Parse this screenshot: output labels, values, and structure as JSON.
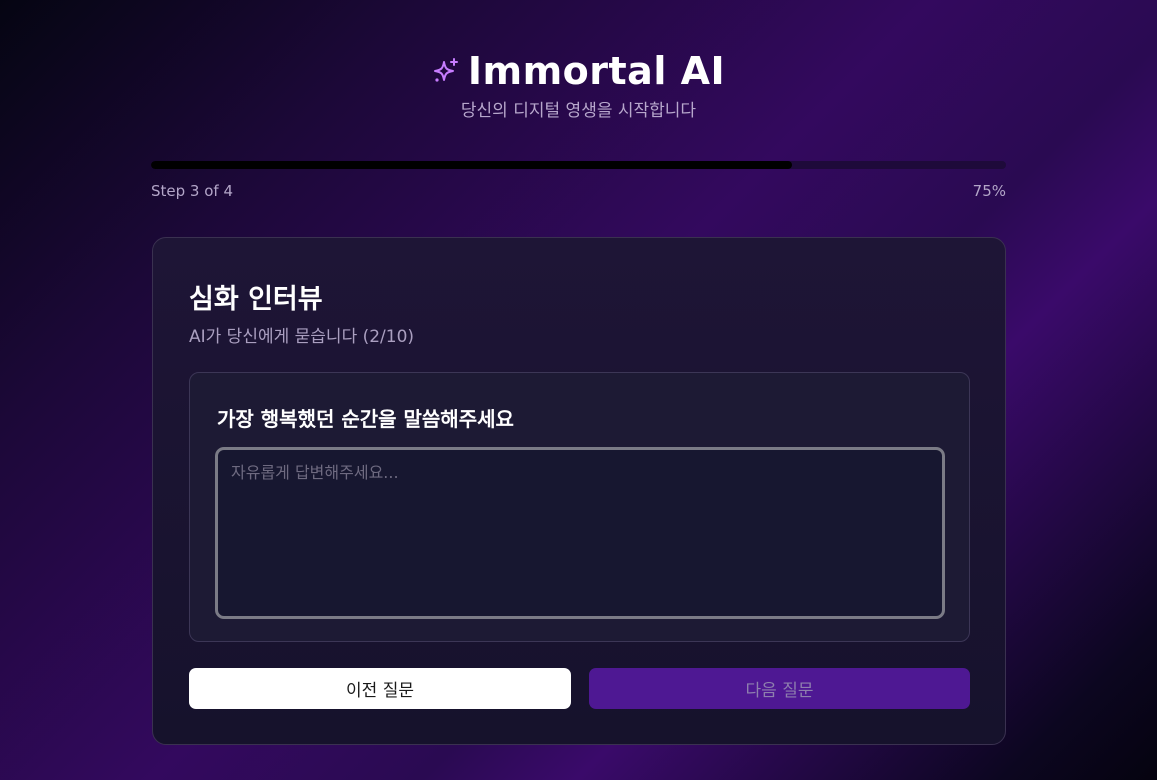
{
  "header": {
    "logo_icon": "sparkle-icon",
    "title": "Immortal AI",
    "subtitle": "당신의 디지털 영생을 시작합니다"
  },
  "progress": {
    "step_text": "Step 3 of 4",
    "percent_text": "75%",
    "fraction": 0.75
  },
  "card": {
    "title": "심화 인터뷰",
    "subtitle": "AI가 당신에게 묻습니다 (2/10)",
    "question": "가장 행복했던 순간을 말씀해주세요",
    "answer_value": "",
    "answer_placeholder": "자유롭게 답변해주세요..."
  },
  "buttons": {
    "prev_label": "이전 질문",
    "next_label": "다음 질문"
  },
  "colors": {
    "accent": "#4e1893",
    "sparkle": "#c77dff",
    "background_purple": "#33095e"
  }
}
